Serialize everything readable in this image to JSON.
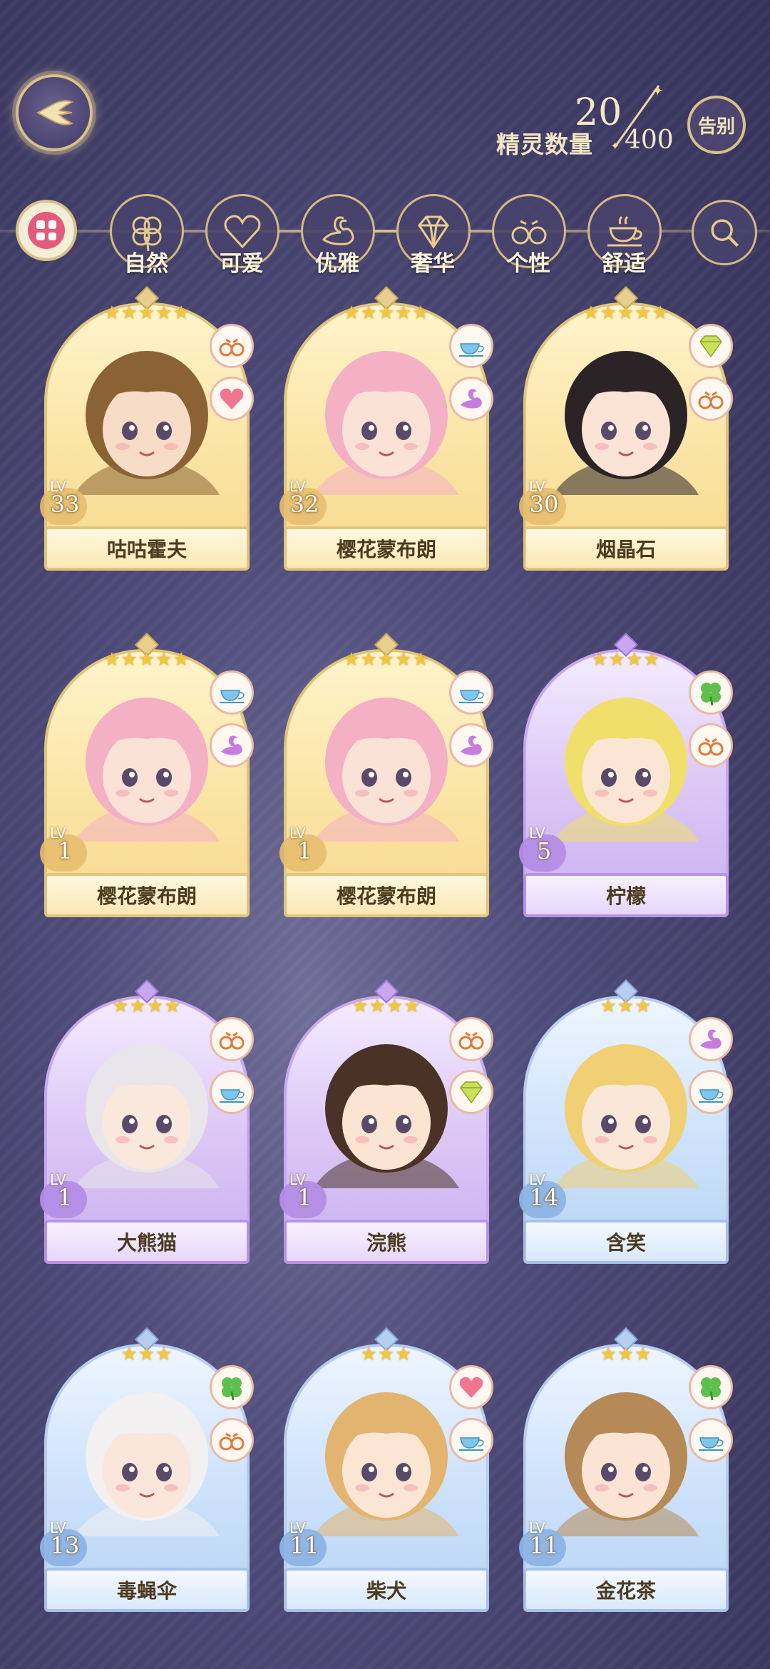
{
  "header": {
    "back_icon": "wing-back-icon",
    "count_label": "精灵数量",
    "count_current": "20",
    "count_max": "400",
    "farewell_label": "告别"
  },
  "filters": [
    {
      "icon": "grid-all-icon",
      "label": ""
    },
    {
      "icon": "clover-icon",
      "label": "自然"
    },
    {
      "icon": "heart-icon",
      "label": "可爱"
    },
    {
      "icon": "swan-icon",
      "label": "优雅"
    },
    {
      "icon": "diamond-icon",
      "label": "奢华"
    },
    {
      "icon": "glasses-icon",
      "label": "个性"
    },
    {
      "icon": "teacup-icon",
      "label": "舒适"
    },
    {
      "icon": "search-icon",
      "label": ""
    }
  ],
  "cards": [
    {
      "name": "咕咕霍夫",
      "lv": "33",
      "stars": "★★★★★",
      "rarity": "gold",
      "badges": [
        "glasses-icon",
        "heart-icon"
      ],
      "hair": "#8a6234",
      "skin": "#f7dcc8"
    },
    {
      "name": "樱花蒙布朗",
      "lv": "32",
      "stars": "★★★★★",
      "rarity": "gold",
      "badges": [
        "teacup-icon",
        "swan-icon"
      ],
      "hair": "#f4b0c4",
      "skin": "#fbe2d6"
    },
    {
      "name": "烟晶石",
      "lv": "30",
      "stars": "★★★★★",
      "rarity": "gold",
      "badges": [
        "diamond-icon",
        "glasses-icon"
      ],
      "hair": "#2b2326",
      "skin": "#fbe4d6"
    },
    {
      "name": "樱花蒙布朗",
      "lv": "1",
      "stars": "★★★★★",
      "rarity": "gold",
      "badges": [
        "teacup-icon",
        "swan-icon"
      ],
      "hair": "#f4b0c4",
      "skin": "#fbe2d6"
    },
    {
      "name": "樱花蒙布朗",
      "lv": "1",
      "stars": "★★★★★",
      "rarity": "gold",
      "badges": [
        "teacup-icon",
        "swan-icon"
      ],
      "hair": "#f4b0c4",
      "skin": "#fbe2d6"
    },
    {
      "name": "柠檬",
      "lv": "5",
      "stars": "★★★★",
      "rarity": "purple",
      "badges": [
        "clover-icon",
        "glasses-icon"
      ],
      "hair": "#f0df6a",
      "skin": "#fbe6d4"
    },
    {
      "name": "大熊猫",
      "lv": "1",
      "stars": "★★★★",
      "rarity": "purple",
      "badges": [
        "glasses-icon",
        "teacup-icon"
      ],
      "hair": "#e8e6ea",
      "skin": "#fbe8dc"
    },
    {
      "name": "浣熊",
      "lv": "1",
      "stars": "★★★★",
      "rarity": "purple",
      "badges": [
        "glasses-icon",
        "diamond-icon"
      ],
      "hair": "#4a3326",
      "skin": "#fbe4d2"
    },
    {
      "name": "含笑",
      "lv": "14",
      "stars": "★★★",
      "rarity": "blue",
      "badges": [
        "swan-icon",
        "teacup-icon"
      ],
      "hair": "#f1cf74",
      "skin": "#fbe7d8"
    },
    {
      "name": "毒蝇伞",
      "lv": "13",
      "stars": "★★★",
      "rarity": "blue",
      "badges": [
        "clover-icon",
        "glasses-icon"
      ],
      "hair": "#f3f0f2",
      "skin": "#fbe6dc"
    },
    {
      "name": "柴犬",
      "lv": "11",
      "stars": "★★★",
      "rarity": "blue",
      "badges": [
        "heart-icon",
        "teacup-icon"
      ],
      "hair": "#e2b470",
      "skin": "#fbe6d4"
    },
    {
      "name": "金花茶",
      "lv": "11",
      "stars": "★★★",
      "rarity": "blue",
      "badges": [
        "clover-icon",
        "teacup-icon"
      ],
      "hair": "#b68a56",
      "skin": "#fbe4d4"
    }
  ]
}
